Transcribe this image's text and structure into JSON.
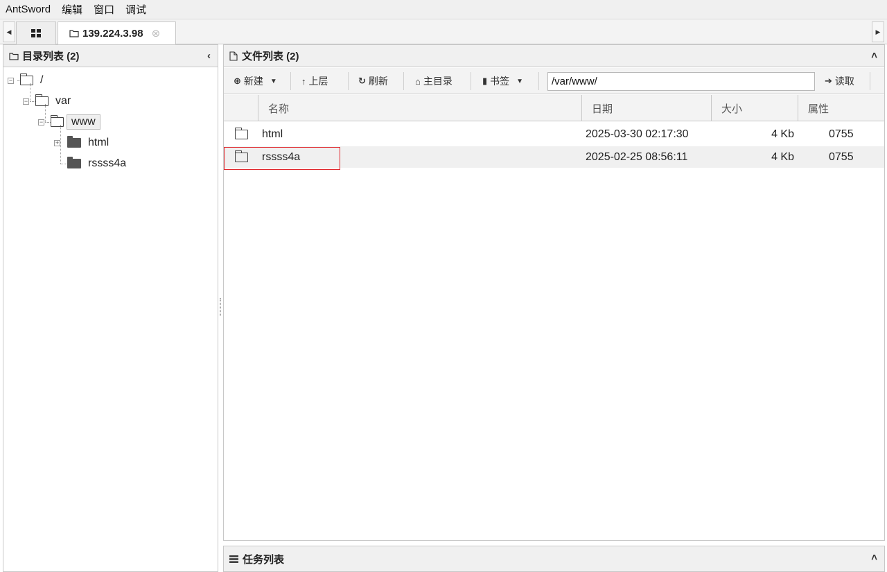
{
  "menu": [
    "AntSword",
    "编辑",
    "窗口",
    "调试"
  ],
  "tabs": {
    "host_label": "139.224.3.98",
    "close_symbol": "⊗"
  },
  "left_panel": {
    "title": "目录列表 (2)",
    "tree": [
      {
        "label": "/",
        "icon": "folder-open-icon",
        "expanded": true
      },
      {
        "label": "var",
        "icon": "folder-open-icon",
        "expanded": true
      },
      {
        "label": "www",
        "icon": "folder-open-icon",
        "expanded": true,
        "selected": true
      },
      {
        "label": "html",
        "icon": "folder-icon",
        "expanded": false
      },
      {
        "label": "rssss4a",
        "icon": "folder-icon"
      }
    ]
  },
  "right_panel": {
    "title": "文件列表 (2)",
    "toolbar": {
      "new_label": "新建",
      "up_label": "上层",
      "refresh_label": "刷新",
      "home_label": "主目录",
      "bookmark_label": "书签",
      "path_value": "/var/www/",
      "read_label": "读取"
    },
    "columns": [
      "名称",
      "日期",
      "大小",
      "属性"
    ],
    "rows": [
      {
        "name": "html",
        "date": "2025-03-30 02:17:30",
        "size": "4 Kb",
        "perm": "0755"
      },
      {
        "name": "rssss4a",
        "date": "2025-02-25 08:56:11",
        "size": "4 Kb",
        "perm": "0755"
      }
    ]
  },
  "task_panel": {
    "title": "任务列表"
  },
  "colors": {
    "highlight": "#e0282d"
  }
}
